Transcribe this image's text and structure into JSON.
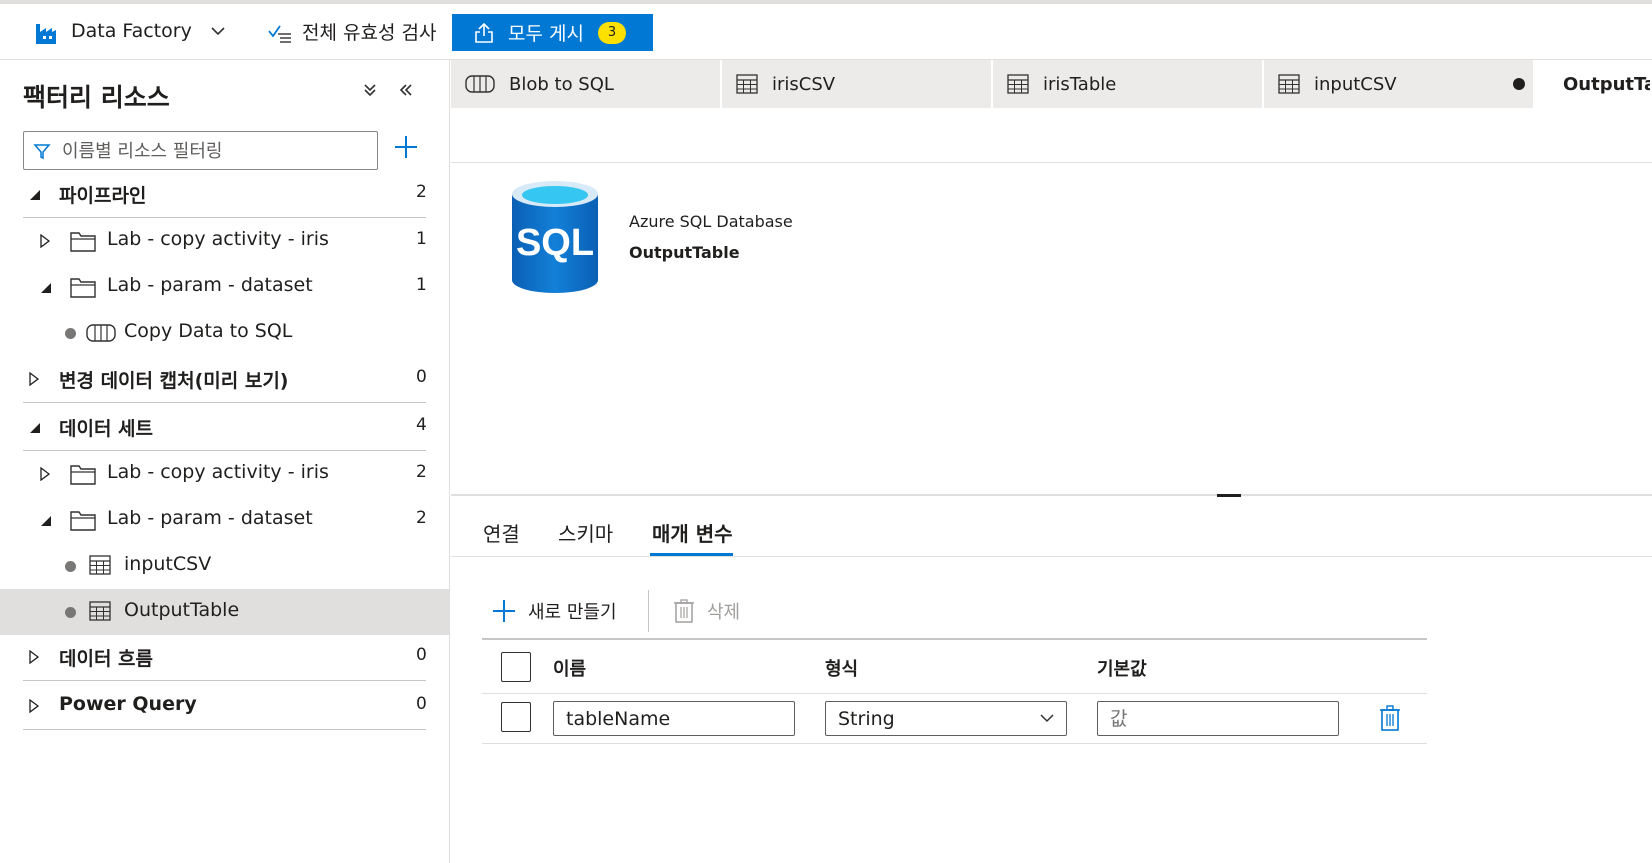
{
  "toolbar": {
    "factory_label": "Data Factory",
    "validate_label": "전체 유효성 검사",
    "publish_label": "모두 게시",
    "publish_count": "3"
  },
  "resources": {
    "title": "팩터리 리소스",
    "filter_placeholder": "이름별 리소스 필터링",
    "rows": [
      {
        "label": "파이프라인",
        "count": "2"
      },
      {
        "label": "Lab - copy activity - iris",
        "count": "1"
      },
      {
        "label": "Lab - param - dataset",
        "count": "1"
      },
      {
        "label": "Copy Data to SQL",
        "count": ""
      },
      {
        "label": "변경 데이터 캡처(미리 보기)",
        "count": "0"
      },
      {
        "label": "데이터 세트",
        "count": "4"
      },
      {
        "label": "Lab - copy activity - iris",
        "count": "2"
      },
      {
        "label": "Lab - param - dataset",
        "count": "2"
      },
      {
        "label": "inputCSV",
        "count": ""
      },
      {
        "label": "OutputTable",
        "count": ""
      },
      {
        "label": "데이터 흐름",
        "count": "0"
      },
      {
        "label": "Power Query",
        "count": "0"
      }
    ]
  },
  "tabs": [
    {
      "label": "Blob to SQL",
      "icon": "pipeline-icon"
    },
    {
      "label": "irisCSV",
      "icon": "table-icon"
    },
    {
      "label": "irisTable",
      "icon": "table-icon"
    },
    {
      "label": "inputCSV",
      "icon": "table-icon"
    },
    {
      "label": "OutputTable",
      "icon": "table-icon"
    }
  ],
  "dataset": {
    "logo_text": "SQL",
    "type": "Azure SQL Database",
    "name": "OutputTable"
  },
  "prop_tabs": [
    "연결",
    "스키마",
    "매개 변수"
  ],
  "actions": {
    "new_label": "새로 만들기",
    "delete_label": "삭제"
  },
  "params_table": {
    "headers": [
      "이름",
      "형식",
      "기본값"
    ],
    "rows": [
      {
        "name": "tableName",
        "type": "String",
        "default_placeholder": "값"
      }
    ]
  }
}
